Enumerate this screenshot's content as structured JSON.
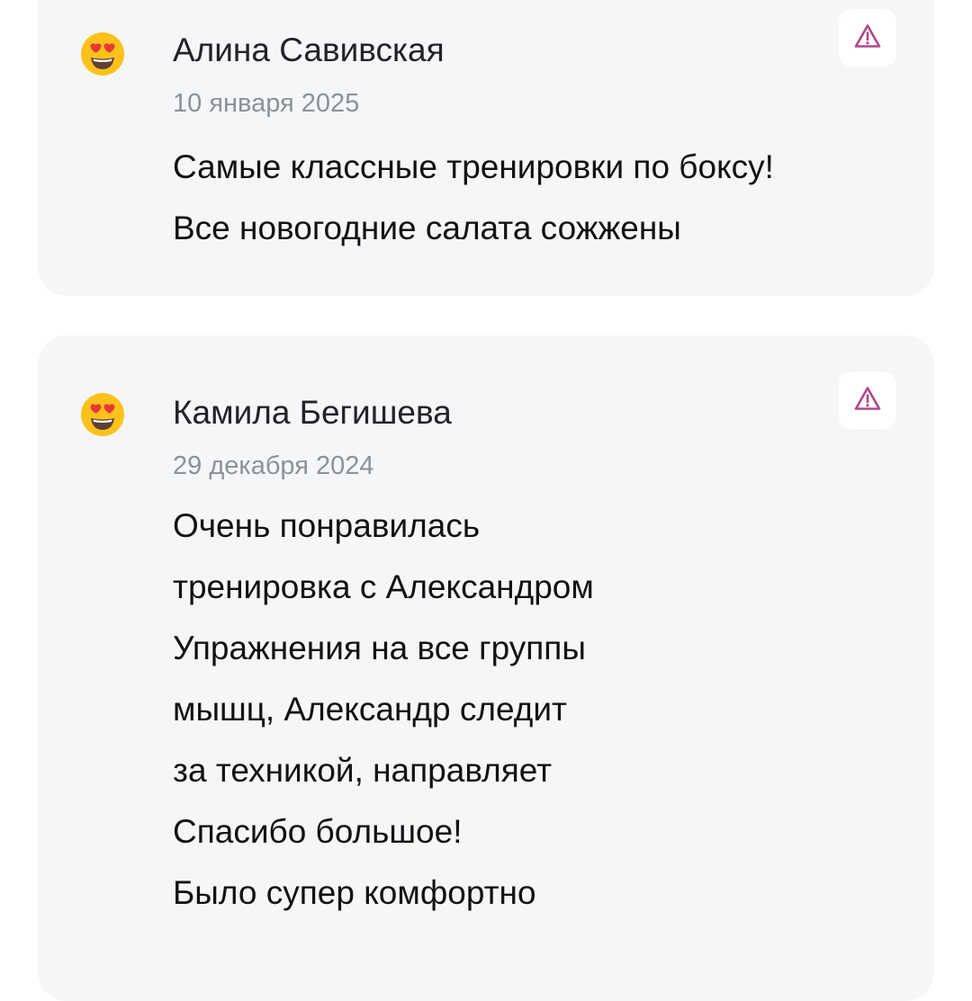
{
  "reviews": [
    {
      "avatar_icon": "smiling-face-with-heart-eyes-icon",
      "author": "Алина Савивская",
      "date": "10 января 2025",
      "lines": [
        "Самые классные тренировки по боксу!",
        "Все новогодние салата сожжены"
      ],
      "report_icon": "warning-triangle-icon"
    },
    {
      "avatar_icon": "smiling-face-with-heart-eyes-icon",
      "author": "Камила Бегишева",
      "date": "29 декабря 2024",
      "lines": [
        "Очень понравилась",
        "тренировка с Александром",
        "Упражнения на все группы",
        "мышц, Александр следит",
        "за техникой, направляет",
        "Спасибо большое!",
        "Было супер комфортно"
      ],
      "report_icon": "warning-triangle-icon"
    }
  ],
  "colors": {
    "card_background": "#f5f6f8",
    "report_icon": "#b0468f",
    "date_text": "#8e9197",
    "name_text": "#222326"
  }
}
